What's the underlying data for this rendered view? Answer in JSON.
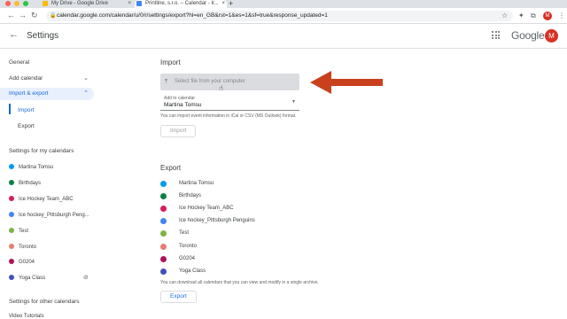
{
  "browser": {
    "tabs": [
      {
        "title": "My Drive - Google Drive",
        "fav_color": "#fbbc04"
      },
      {
        "title": "Printline, s.r.o. – Calendar - Ir...",
        "fav_color": "#4285f4"
      }
    ],
    "url": "calendar.google.com/calendar/u/0/r/settings/export?hl=en_GB&rst=1&es=1&sf=true&response_updated=1",
    "profile_initial": "M"
  },
  "app": {
    "title": "Settings",
    "logo_text": "Google",
    "avatar_initial": "M"
  },
  "sidebar": {
    "general": "General",
    "add_calendar": "Add calendar",
    "import_export": "Import & export",
    "import": "Import",
    "export": "Export",
    "my_calendars_heading": "Settings for my calendars",
    "other_calendars_heading": "Settings for other calendars",
    "other_first": "Video Tutorials"
  },
  "calendars": [
    {
      "name": "Martina Tomsu",
      "color": "#039be5"
    },
    {
      "name": "Birthdays",
      "color": "#0b8043"
    },
    {
      "name": "Ice Hockey Team_ABC",
      "color": "#d81b60"
    },
    {
      "name": "Ice hockey_Pittsburgh Penguins",
      "sidebar_name": "Ice hockey_Pittsburgh Peng...",
      "color": "#4285f4"
    },
    {
      "name": "Test",
      "color": "#7cb342"
    },
    {
      "name": "Toronto",
      "color": "#e67c73"
    },
    {
      "name": "G0204",
      "color": "#ad1457"
    },
    {
      "name": "Yoga Class",
      "color": "#3f51b5"
    }
  ],
  "import_section": {
    "heading": "Import",
    "file_button": "Select file from your computer",
    "add_to_label": "Add to calendar",
    "add_to_value": "Martina Tomsu",
    "help": "You can import event information in iCal or CSV (MS Outlook) format.",
    "import_button": "Import"
  },
  "export_section": {
    "heading": "Export",
    "help": "You can download all calendars that you can view and modify in a single archive.",
    "export_button": "Export"
  }
}
